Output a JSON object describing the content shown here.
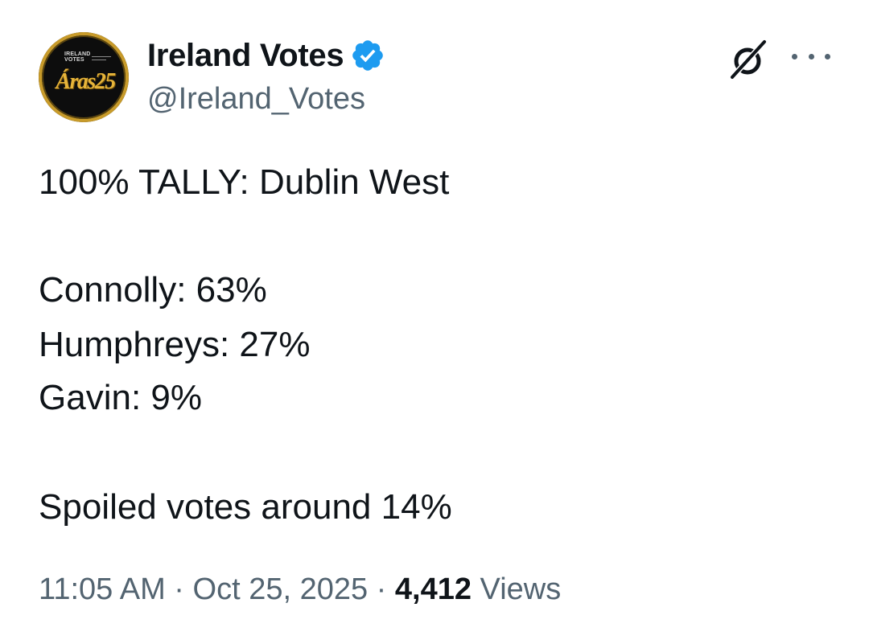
{
  "account": {
    "display_name": "Ireland Votes",
    "handle": "@Ireland_Votes",
    "verified": true,
    "avatar": {
      "small_text_line1": "IRELAND",
      "small_text_line2": "VOTES",
      "brand_text": "Áras25",
      "colors": {
        "background": "#0d0d0d",
        "ring": "#c89b2a",
        "brand": "#e6b43a"
      }
    }
  },
  "actions": {
    "grok_icon": "grok-icon",
    "more_icon": "more-icon"
  },
  "post": {
    "headline": "100% TALLY: Dublin West",
    "results": [
      "Connolly: 63%",
      "Humphreys: 27%",
      "Gavin: 9%"
    ],
    "note": "Spoiled votes around 14%"
  },
  "meta": {
    "time": "11:05 AM",
    "separator": "·",
    "date": "Oct 25, 2025",
    "views_count": "4,412",
    "views_label": "Views"
  },
  "colors": {
    "text_primary": "#0f1419",
    "text_secondary": "#536471",
    "verified_blue": "#1d9bf0"
  }
}
